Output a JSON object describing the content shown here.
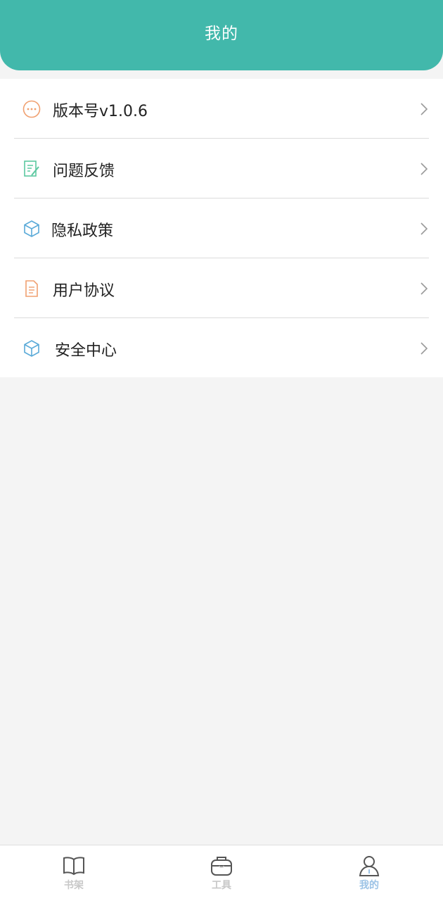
{
  "header": {
    "title": "我的"
  },
  "menu": {
    "items": [
      {
        "label": "版本号v1.0.6",
        "icon": "more-circle-icon",
        "icon_color": "#f0a070"
      },
      {
        "label": "问题反馈",
        "icon": "feedback-edit-icon",
        "icon_color": "#5cc8a0"
      },
      {
        "label": "隐私政策",
        "icon": "cube-icon",
        "icon_color": "#5aaad8"
      },
      {
        "label": "用户协议",
        "icon": "document-icon",
        "icon_color": "#f0a070"
      },
      {
        "label": "安全中心",
        "icon": "cube-icon",
        "icon_color": "#5aaad8"
      }
    ]
  },
  "tabbar": {
    "tabs": [
      {
        "label": "书架",
        "icon": "book-icon",
        "active": false
      },
      {
        "label": "工具",
        "icon": "toolbox-icon",
        "active": false
      },
      {
        "label": "我的",
        "icon": "user-icon",
        "active": true
      }
    ]
  },
  "colors": {
    "header_bg": "#42b8ab",
    "page_bg": "#f4f4f4",
    "active_tab": "#9cc3e6",
    "inactive_tab": "#c8c8c8"
  }
}
